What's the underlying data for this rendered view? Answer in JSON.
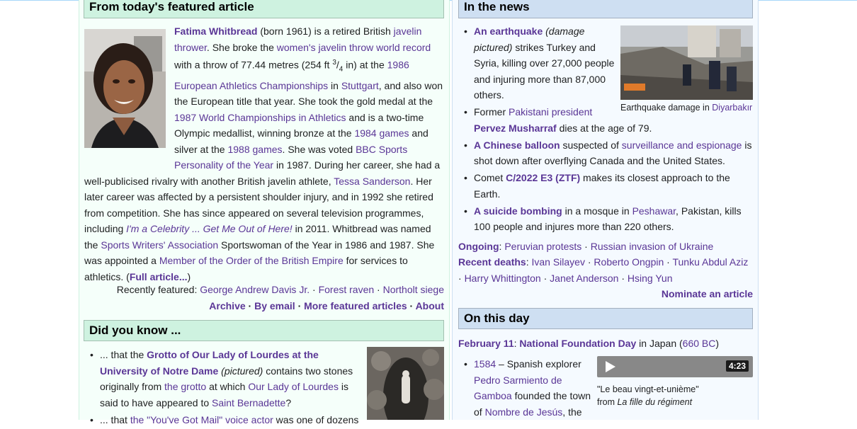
{
  "featured": {
    "heading": "From today's featured article",
    "l1a": "Fatima Whitbread",
    "l1b": " (born 1961) is a retired British ",
    "l1c": "javelin",
    "l2a": "thrower",
    "l2b": ". She broke the ",
    "l2c": "women's javelin throw world record",
    "l3a": "with a throw of 77.44 metres (254 ft ",
    "l3sup": "3",
    "l3sub": "4",
    "l3b": " in) at the ",
    "l3c": "1986",
    "l4a": "European Athletics Championships",
    "l4b": " in ",
    "l4c": "Stuttgart",
    "l4d": ", and also won",
    "l5": "the European title that year. She took the gold medal at the",
    "l6a": "1987 World Championships in Athletics",
    "l6b": " and is a two-time",
    "l7a": "Olympic medallist, winning bronze at the ",
    "l7b": "1984 games",
    "l7c": " and",
    "l8a": "silver at the ",
    "l8b": "1988 games",
    "l8c": ". She was voted ",
    "l8d": "BBC Sports",
    "l9a": "Personality of the Year",
    "l9b": " in 1987. During her career, she had a",
    "l10a": "well-publicised rivalry with another British javelin athlete, ",
    "l10b": "Tessa Sanderson",
    "l10c": ". Her",
    "l11": "later career was affected by a persistent shoulder injury, and in 1992 she retired",
    "l12": "from competition. She has since appeared on several television programmes,",
    "l13a": "including ",
    "l13b": "I'm a Celebrity ... Get Me Out of Here!",
    "l13c": " in 2011. Whitbread was named",
    "l14a": "the ",
    "l14b": "Sports Writers' Association",
    "l14c": " Sportswoman of the Year in 1986 and 1987. She",
    "l15a": "was appointed a ",
    "l15b": "Member of the Order of the British Empire",
    "l15c": " for services to",
    "l16a": "athletics. (",
    "l16b": "Full article...",
    "l16c": ")",
    "recent_label": "Recently featured: ",
    "recent": [
      "George Andrew Davis Jr.",
      "Forest raven",
      "Northolt siege"
    ],
    "links": [
      "Archive",
      "By email",
      "More featured articles",
      "About"
    ],
    "sep": " · "
  },
  "dyk": {
    "heading": "Did you know ...",
    "i1a": "... that the ",
    "i1b": "Grotto of Our Lady of Lourdes at the",
    "i1c": "University of Notre Dame",
    "i1d": " (pictured)",
    "i1e": " contains two stones",
    "i1f": "originally from ",
    "i1g": "the grotto",
    "i1h": " at which ",
    "i1i": "Our Lady of Lourdes",
    "i1j": " is",
    "i1k": "said to have appeared to ",
    "i1l": "Saint Bernadette",
    "i1m": "?",
    "i2a": "... that ",
    "i2b": "the \"You've Got Mail\" voice actor",
    "i2c": " was one of dozens"
  },
  "news": {
    "heading": "In the news",
    "caption_a": "Earthquake damage in ",
    "caption_b": "Diyarbakır",
    "n1a": "An earthquake",
    "n1b": " (damage",
    "n1c": "pictured)",
    "n1d": " strikes Turkey and",
    "n1e": "Syria, killing over 27,000 people",
    "n1f": "and injuring more than 87,000",
    "n1g": "others.",
    "n2a": "Former ",
    "n2b": "Pakistani president",
    "n2c": "Pervez Musharraf",
    "n2d": " dies at the age of 79.",
    "n3a": "A Chinese balloon",
    "n3b": " suspected of ",
    "n3c": "surveillance and espionage",
    "n3d": " is",
    "n3e": "shot down after overflying Canada and the United States.",
    "n4a": "Comet ",
    "n4b": "C/2022 E3 (ZTF)",
    "n4c": " makes its closest approach to the",
    "n4d": "Earth.",
    "n5a": "A suicide bombing",
    "n5b": " in a mosque in ",
    "n5c": "Peshawar",
    "n5d": ", Pakistan, kills",
    "n5e": "100 people and injures more than 220 others.",
    "ongoing_label": "Ongoing",
    "ongoing": [
      "Peruvian protests",
      "Russian invasion of Ukraine"
    ],
    "deaths_label": "Recent deaths",
    "deaths": [
      "Ivan Silayev",
      "Roberto Ongpin",
      "Tunku Abdul Aziz",
      "Harry Whittington",
      "Janet Anderson",
      "Hsing Yun"
    ],
    "nominate": "Nominate an article"
  },
  "otd": {
    "heading": "On this day",
    "date": "February 11",
    "colon": ": ",
    "event": "National Foundation Day",
    "in_japan": " in Japan (",
    "bc": "660 BC",
    "close": ")",
    "y1": "1584",
    "y1a": " – Spanish explorer",
    "y1b": "Pedro Sarmiento de",
    "y1c": "Gamboa",
    "y1d": " founded the town",
    "y1e": "of ",
    "y1f": "Nombre de Jesús",
    "y1g": ", the",
    "video_duration": "4:23",
    "vcap1": "\"Le beau vingt-et-unième\"",
    "vcap2a": "from ",
    "vcap2b": "La fille du régiment"
  }
}
